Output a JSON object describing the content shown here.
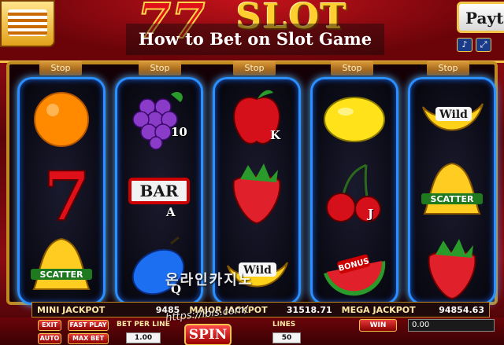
{
  "title_banner": "How to Bet on Slot Game",
  "marquee": {
    "logo_text": "SLOT",
    "paytable_label": "Payt"
  },
  "stop_label": "Stop",
  "reels": [
    {
      "symbols": [
        "orange",
        "seven",
        "scatter-bell"
      ],
      "suffixes": [
        "",
        "",
        ""
      ]
    },
    {
      "symbols": [
        "grapes",
        "bar",
        "plum"
      ],
      "suffixes": [
        "10",
        "A",
        "Q"
      ]
    },
    {
      "symbols": [
        "apple",
        "strawberry",
        "banana-wild"
      ],
      "suffixes": [
        "K",
        "",
        ""
      ]
    },
    {
      "symbols": [
        "lemon",
        "cherries",
        "watermelon-bonus"
      ],
      "suffixes": [
        "",
        "J",
        ""
      ]
    },
    {
      "symbols": [
        "banana-wild",
        "scatter-bell",
        "strawberry"
      ],
      "suffixes": [
        "",
        "",
        ""
      ]
    }
  ],
  "symbol_texts": {
    "bar": "BAR",
    "wild": "Wild",
    "scatter": "SCATTER",
    "bonus": "BONUS"
  },
  "jackpots": [
    {
      "label": "MINI JACKPOT",
      "amount": "9485"
    },
    {
      "label": "MAJOR JACKPOT",
      "amount": "31518.71"
    },
    {
      "label": "MEGA JACKPOT",
      "amount": "94854.63"
    }
  ],
  "controls": {
    "exit": "EXIT",
    "fast_play": "FAST PLAY",
    "auto": "AUTO",
    "max_bet": "MAX BET",
    "bet_per_line_label": "BET PER LINE",
    "bet_per_line_value": "1.00",
    "lines_label": "LINES",
    "lines_value": "50",
    "spin": "SPIN",
    "win_label": "WIN",
    "win_value": "0.00"
  },
  "watermark": {
    "text": "온라인카지노",
    "url": "https://ibis.com/"
  },
  "colors": {
    "reel_border": "#2a8fff",
    "gold": "#f3c54a",
    "cabinet_red": "#8b0a12"
  }
}
